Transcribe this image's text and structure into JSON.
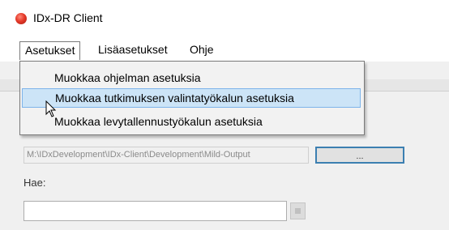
{
  "window": {
    "title": "IDx-DR Client"
  },
  "menubar": {
    "items": [
      {
        "label": "Asetukset"
      },
      {
        "label": "Lisäasetukset"
      },
      {
        "label": "Ohje"
      }
    ]
  },
  "dropdown": {
    "items": [
      {
        "label": "Muokkaa ohjelman asetuksia"
      },
      {
        "label": "Muokkaa tutkimuksen valintatyökalun asetuksia",
        "highlighted": true
      },
      {
        "label": "Muokkaa levytallennustyökalun asetuksia"
      }
    ]
  },
  "form": {
    "path_value": "M:\\IDxDevelopment\\IDx-Client\\Development\\Mild-Output",
    "browse_label": "...",
    "search_label": "Hae:",
    "search_value": ""
  },
  "colors": {
    "highlight_bg": "#cce4f7",
    "highlight_border": "#7eb4ea",
    "button_border": "#3c7fb1",
    "app_icon": "#e53a2a"
  }
}
